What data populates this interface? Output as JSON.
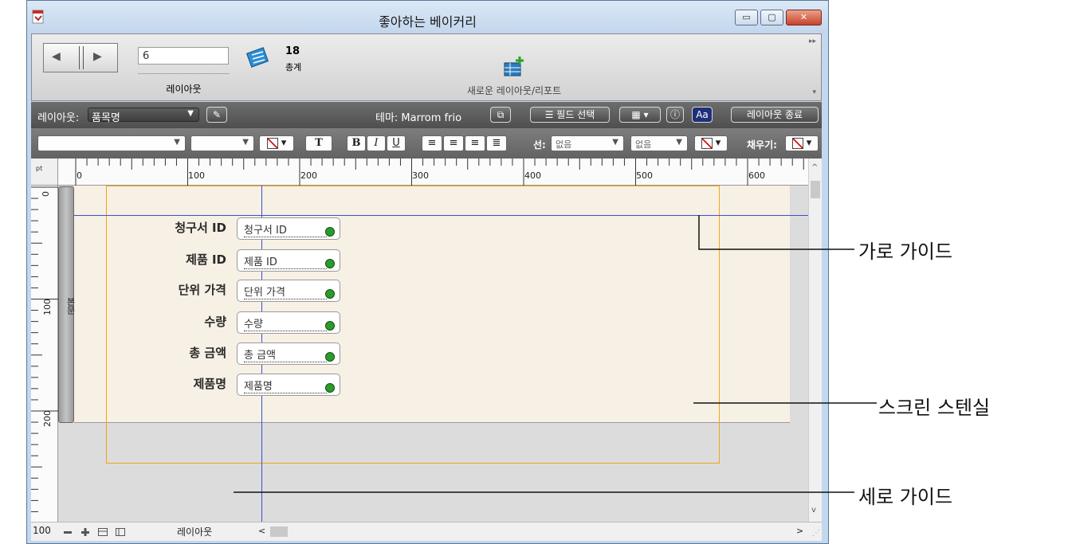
{
  "window": {
    "title": "좋아하는 베이커리",
    "close_glyph": "✕",
    "minimize_glyph": "▭",
    "maximize_glyph": "▢"
  },
  "status_toolbar": {
    "current_record": "6",
    "layout_caption": "레이아웃",
    "record_count": "18",
    "record_count_label": "총계",
    "new_layout_label": "새로운 레이아웃/리포트",
    "prev_glyph": "◀",
    "next_glyph": "▶"
  },
  "layout_bar": {
    "layout_prefix": "레이아웃:",
    "layout_name": "품목명",
    "theme_label": "테마: Marrom frio",
    "field_picker_label": "필드 선택",
    "exit_layout_label": "레이아웃 종료",
    "format_painter_glyph": "Aa"
  },
  "format_bar": {
    "text_button": "T",
    "bold": "B",
    "italic": "I",
    "underline": "U",
    "line_label": "선:",
    "line_style_value": "없음",
    "line_width_value": "없음",
    "fill_label": "채우기:"
  },
  "rulers": {
    "unit": "pt",
    "horizontal_labels": [
      "0",
      "100",
      "200",
      "300",
      "400",
      "500",
      "600"
    ],
    "vertical_labels": [
      "0",
      "100",
      "200"
    ]
  },
  "layout_part": {
    "name": "본문"
  },
  "fields": [
    {
      "label": "청구서 ID",
      "field": "청구서 ID"
    },
    {
      "label": "제품 ID",
      "field": "제품 ID"
    },
    {
      "label": "단위 가격",
      "field": "단위 가격"
    },
    {
      "label": "수량",
      "field": "수량"
    },
    {
      "label": "총 금액",
      "field": "총 금액"
    },
    {
      "label": "제품명",
      "field": "제품명"
    }
  ],
  "bottom_bar": {
    "zoom": "100",
    "mode": "레이아웃"
  },
  "callouts": {
    "horizontal_guide": "가로 가이드",
    "screen_stencil": "스크린 스텐실",
    "vertical_guide": "세로 가이드"
  },
  "colors": {
    "guide": "#3b4fd8",
    "stencil": "#f2a31b",
    "layout_background": "#f7f0e4",
    "magnifier": "#2c9a2c"
  }
}
